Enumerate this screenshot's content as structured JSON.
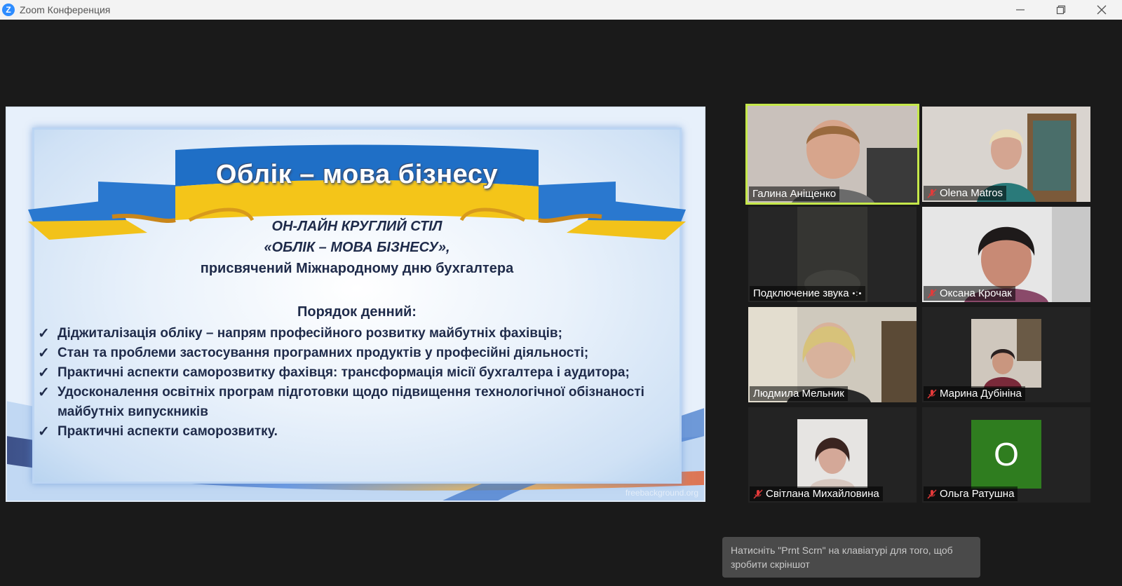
{
  "window": {
    "title": "Zoom Конференция",
    "logo_letter": "Z"
  },
  "slide": {
    "title": "Облік – мова бізнесу",
    "subtitle_line1": "ОН-ЛАЙН КРУГЛИЙ СТІЛ",
    "subtitle_line2": "«ОБЛІК – МОВА БІЗНЕСУ»,",
    "subtitle_line3": "присвячений Міжнародному дню бухгалтера",
    "agenda_title": "Порядок денний:",
    "agenda_items": [
      "Діджиталізація обліку – напрям професійного розвитку майбутніх фахівців;",
      "Стан та проблеми застосування програмних продуктів у професійні діяльності;",
      "Практичні аспекти саморозвитку фахівця: трансформація місії бухгалтера і аудитора;",
      "Удосконалення освітніх програм підготовки щодо підвищення технологічної обізнаності майбутніх випускників",
      "Практичні аспекти саморозвитку."
    ],
    "check_mark": "✓",
    "watermark": "freebackground.org"
  },
  "participants": [
    {
      "name": "Галина Аніщенко",
      "muted": false,
      "active_speaker": true
    },
    {
      "name": "Olena Matros",
      "muted": true,
      "active_speaker": false
    },
    {
      "name": "Подключение звука",
      "muted": false,
      "active_speaker": false,
      "connecting": true
    },
    {
      "name": "Оксана Крочак",
      "muted": true,
      "active_speaker": false
    },
    {
      "name": "Людмила Мельник",
      "muted": false,
      "active_speaker": false
    },
    {
      "name": "Марина Дубініна",
      "muted": true,
      "active_speaker": false
    },
    {
      "name": "Світлана Михайловина",
      "muted": true,
      "active_speaker": false
    },
    {
      "name": "Ольга Ратушна",
      "muted": true,
      "active_speaker": false,
      "avatar_letter": "О",
      "avatar_color": "#2f7d1f"
    }
  ],
  "toast": {
    "text": "Натисніть \"Prnt Scrn\" на клавіатурі для того, щоб зробити скріншот"
  },
  "colors": {
    "active_speaker_border": "#c5e84a",
    "mute_icon": "#e23a3a",
    "ribbon_blue": "#1e6fc7",
    "ribbon_yellow": "#f5c518"
  }
}
